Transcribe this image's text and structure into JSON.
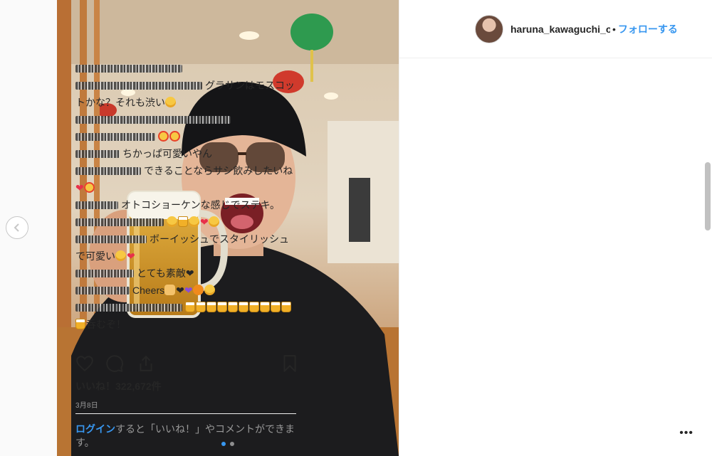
{
  "post": {
    "username": "haruna_kawaguchi_of",
    "separator": "•",
    "follow_label": "フォローする"
  },
  "comments": [
    {
      "text": ""
    },
    {
      "text": "グラサンはモスコットかな？それも渋い"
    },
    {
      "text": ""
    },
    {
      "text": ""
    },
    {
      "text": "ちかっぱ可愛いやん"
    },
    {
      "text": "できることならサシ飲みしたいね"
    },
    {
      "text": "オトコショーケンな感じでステキ。"
    },
    {
      "text": ""
    },
    {
      "text": "ボーイッシュでスタイリッシュで可愛い"
    },
    {
      "text": "とても素敵"
    },
    {
      "text": "Cheers"
    },
    {
      "text": "呑むぞ！"
    }
  ],
  "stats": {
    "likes": "いいね！322,672件",
    "date": "3月8日"
  },
  "footer": {
    "login_link": "ログイン",
    "login_text": "すると「いいね！」やコメントができます。",
    "more": "•••"
  },
  "icons": {
    "prev": "chevron-left-icon",
    "like": "heart-icon",
    "comment": "comment-bubble-icon",
    "share": "share-icon",
    "save": "bookmark-icon"
  },
  "colors": {
    "accent": "#3897f0",
    "text": "#262626",
    "muted": "#999999"
  }
}
